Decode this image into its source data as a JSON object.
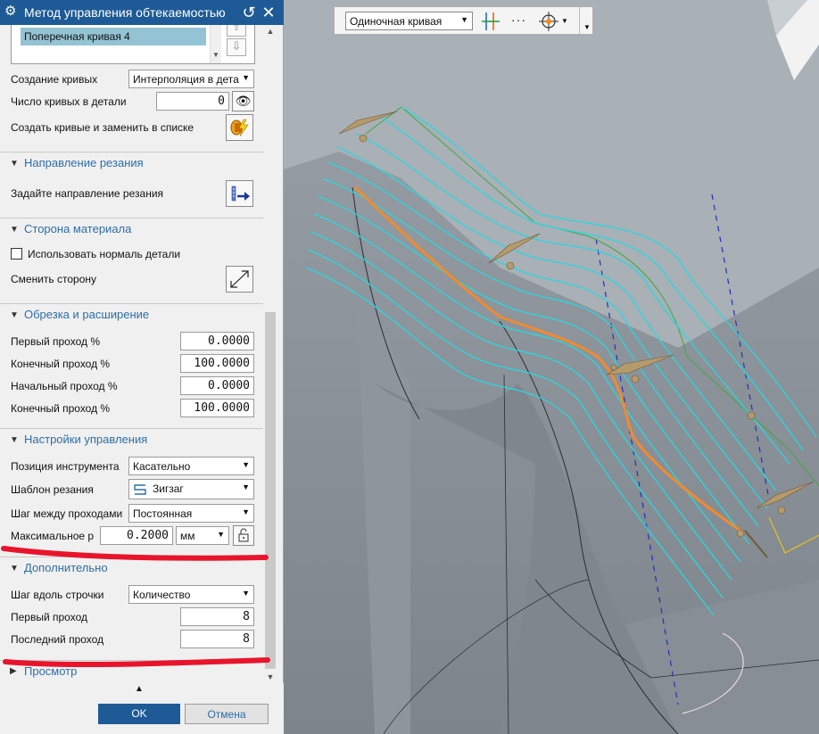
{
  "dialog": {
    "title": "Метод управления обтекаемостью",
    "list_selected": "Поперечная кривая 4",
    "creation": {
      "label": "Создание кривых",
      "value": "Интерполяция в дета"
    },
    "curve_count": {
      "label": "Число кривых в детали",
      "value": "0"
    },
    "create_replace": {
      "label": "Создать кривые и заменить в списке"
    },
    "cut_direction": {
      "section": "Направление резания",
      "label": "Задайте направление резания"
    },
    "material_side": {
      "section": "Сторона материала",
      "checkbox_label": "Использовать нормаль детали",
      "flip_label": "Сменить сторону"
    },
    "trim": {
      "section": "Обрезка и расширение",
      "rows": [
        {
          "label": "Первый проход %",
          "value": "0.0000"
        },
        {
          "label": "Конечный проход %",
          "value": "100.0000"
        },
        {
          "label": "Начальный проход %",
          "value": "0.0000"
        },
        {
          "label": "Конечный проход %",
          "value": "100.0000"
        }
      ]
    },
    "drive": {
      "section": "Настройки управления",
      "tool_position": {
        "label": "Позиция инструмента",
        "value": "Касательно"
      },
      "cut_pattern": {
        "label": "Шаблон резания",
        "value": "Зигзаг"
      },
      "stepover": {
        "label": "Шаг между проходами",
        "value": "Постоянная"
      },
      "max_distance": {
        "label": "Максимальное р",
        "value": "0.2000",
        "unit": "мм"
      }
    },
    "more": {
      "section": "Дополнительно",
      "step_along": {
        "label": "Шаг вдоль строчки",
        "value": "Количество"
      },
      "first_pass": {
        "label": "Первый проход",
        "value": "8"
      },
      "last_pass": {
        "label": "Последний проход",
        "value": "8"
      }
    },
    "preview": {
      "section": "Просмотр"
    },
    "ok_label": "OK",
    "cancel_label": "Отмена"
  },
  "toolbar": {
    "selection_filter": "Одиночная кривая"
  },
  "colors": {
    "title_bar": "#1e5b96",
    "section_text": "#2d6ea6",
    "list_selection": "#94c4d3",
    "toolpath": "#28d8e0",
    "selected_curve": "#f28a2e",
    "annotation": "#e8142c"
  }
}
